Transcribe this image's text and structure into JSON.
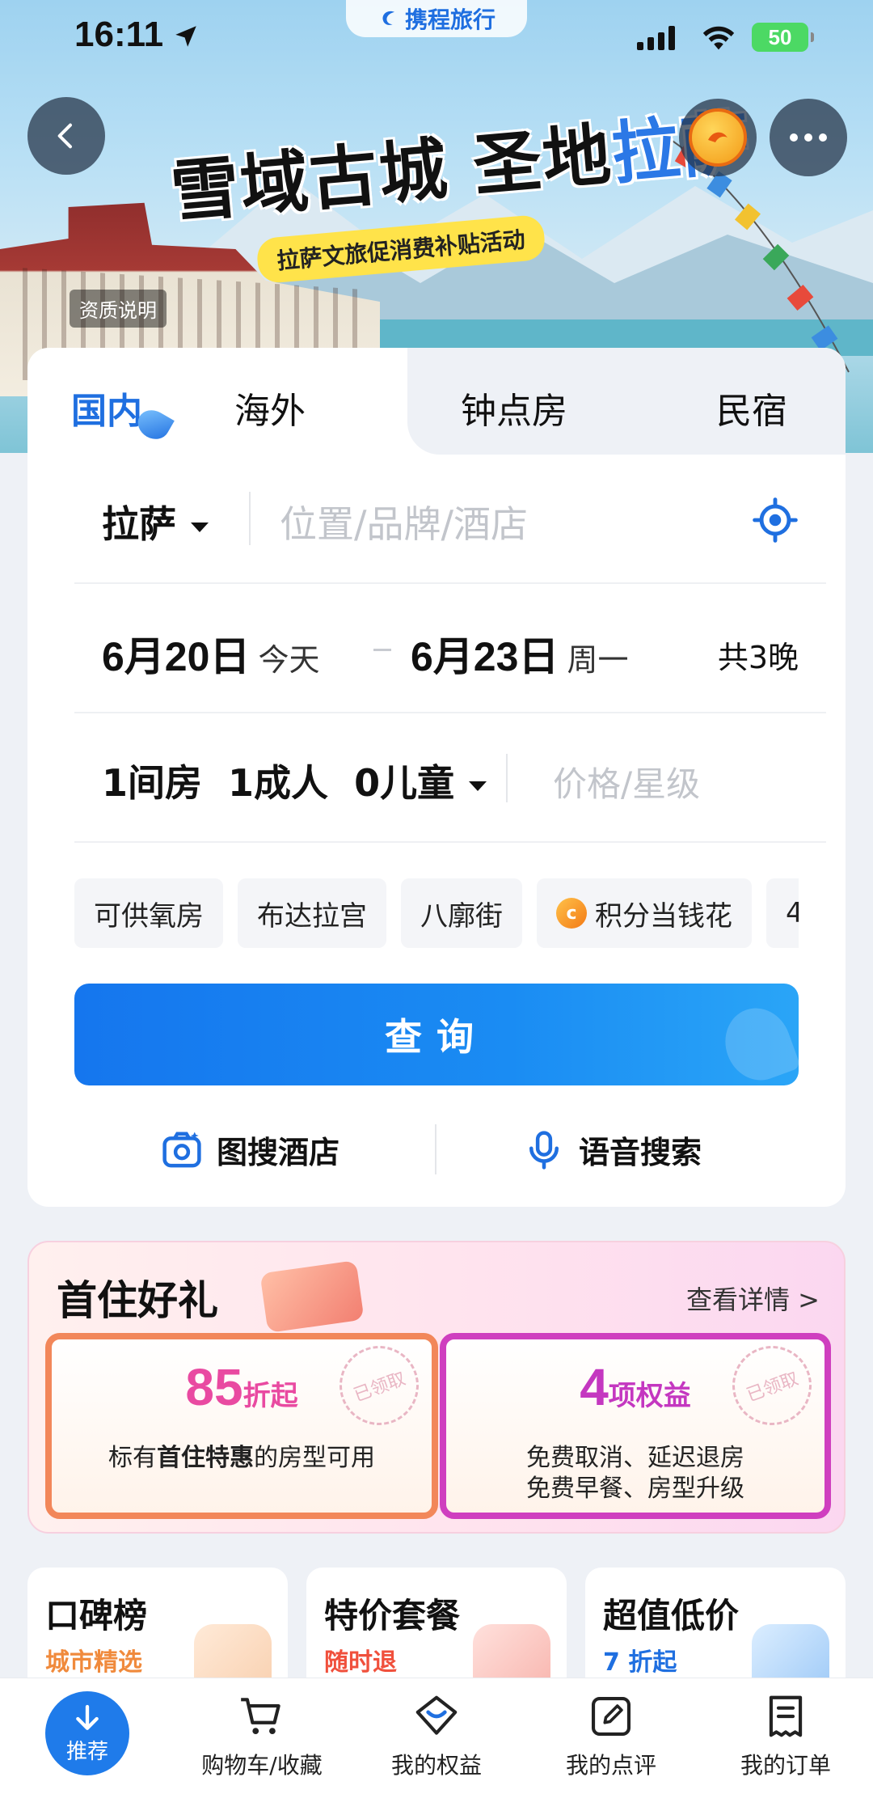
{
  "status_bar": {
    "time": "16:11",
    "app_name": "携程旅行",
    "battery": "50"
  },
  "hero": {
    "title_black": "雪域古城 圣地",
    "title_blue": "拉萨",
    "subtitle": "拉萨文旅促消费补贴活动",
    "qualification": "资质说明"
  },
  "tabs": [
    {
      "label": "国内",
      "active": true
    },
    {
      "label": "海外",
      "active": false
    },
    {
      "label": "钟点房",
      "active": false
    },
    {
      "label": "民宿",
      "active": false
    }
  ],
  "search": {
    "city": "拉萨",
    "placeholder": "位置/品牌/酒店",
    "checkin_date": "6月20日",
    "checkin_day": "今天",
    "checkout_date": "6月23日",
    "checkout_day": "周一",
    "nights": "共3晚",
    "guests": "1间房  1成人  0儿童",
    "price_placeholder": "价格/星级",
    "chips": [
      "可供氧房",
      "布达拉宫",
      "八廓街",
      "积分当钱花",
      "4"
    ],
    "query_label": "查询",
    "image_search": "图搜酒店",
    "voice_search": "语音搜索"
  },
  "promo": {
    "title": "首住好礼",
    "link": "查看详情 >",
    "left_value": "85",
    "left_unit": "折起",
    "left_desc_prefix": "标有",
    "left_desc_bold": "首住特惠",
    "left_desc_suffix": "的房型可用",
    "left_stamp": "已领取",
    "right_value": "4",
    "right_unit": "项权益",
    "right_desc_1": "免费取消、延迟退房",
    "right_desc_2": "免费早餐、房型升级",
    "right_stamp": "已领取"
  },
  "features": [
    {
      "title": "口碑榜",
      "subtitle": "城市精选",
      "color": "#f08a3c"
    },
    {
      "title": "特价套餐",
      "subtitle": "随时退",
      "color": "#f0503c"
    },
    {
      "title": "超值低价",
      "subtitle": "7 折起",
      "color": "#1f6fe0"
    }
  ],
  "tabbar": {
    "recommend": "推荐",
    "cart": "购物车/收藏",
    "benefits": "我的权益",
    "reviews": "我的点评",
    "orders": "我的订单"
  },
  "colors": {
    "brand_blue": "#1f6fe0",
    "promo_pink": "#e94aa1",
    "promo_purple": "#c437c0"
  }
}
